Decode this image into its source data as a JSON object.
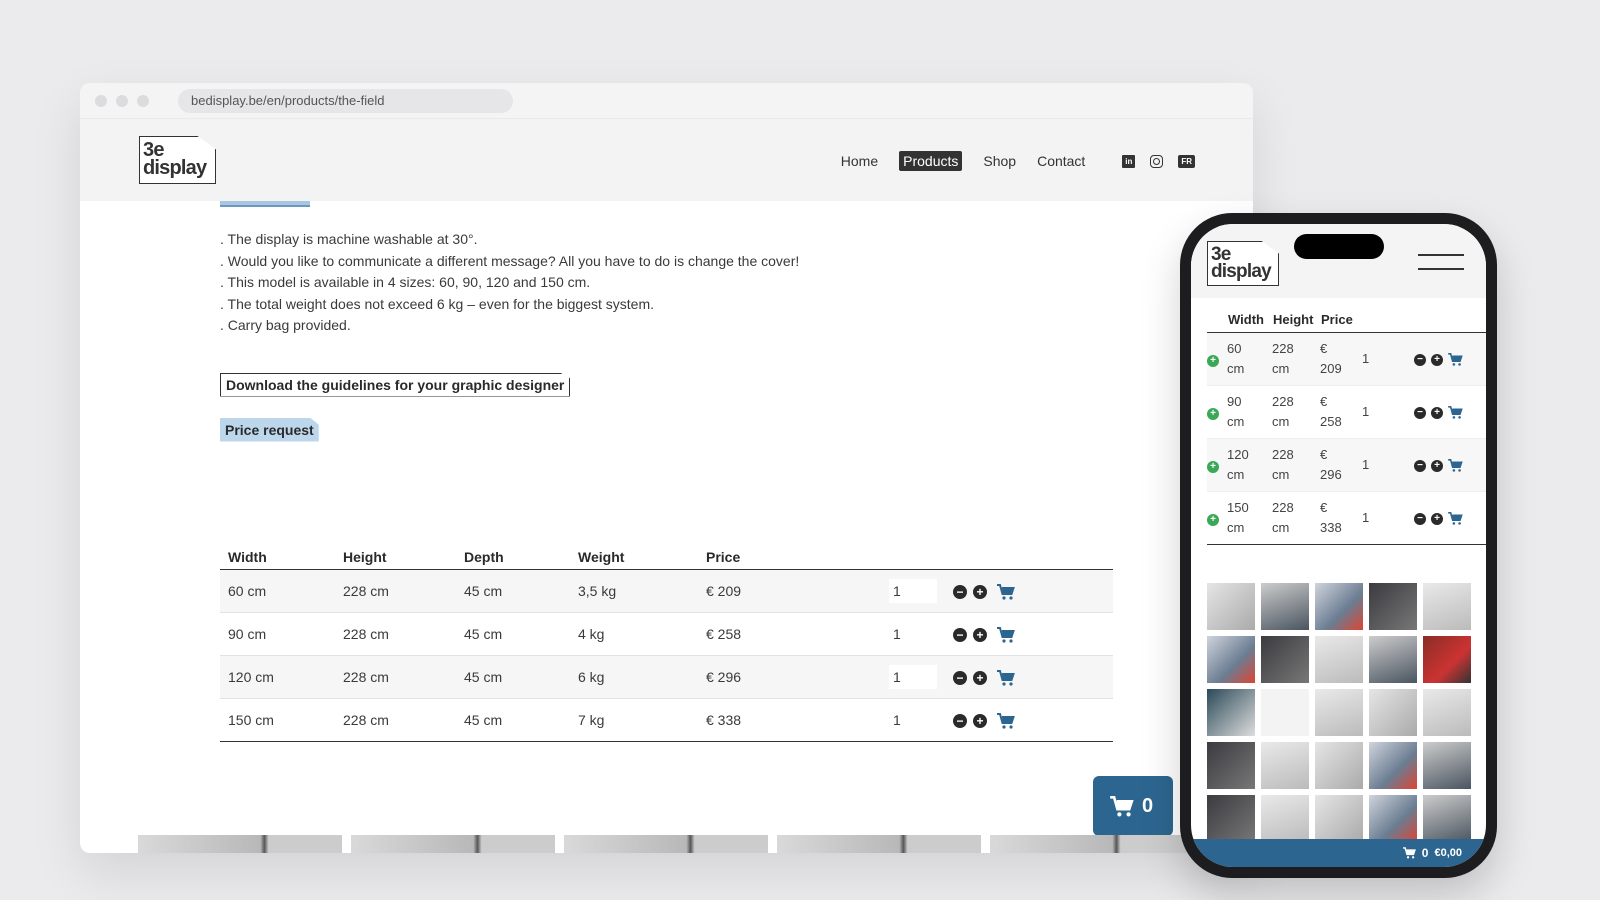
{
  "browser": {
    "url": "bedisplay.be/en/products/the-field"
  },
  "logo": {
    "line1": "3e",
    "line2": "display"
  },
  "nav": {
    "items": [
      {
        "label": "Home",
        "active": false
      },
      {
        "label": "Products",
        "active": true
      },
      {
        "label": "Shop",
        "active": false
      },
      {
        "label": "Contact",
        "active": false
      }
    ],
    "language": "FR"
  },
  "content": {
    "features": [
      ". The display is machine washable at 30°.",
      ". Would you like to communicate a different message? All you have to do is change the cover!",
      ". This model is available in 4 sizes: 60, 90, 120 and 150 cm.",
      ". The total weight does not exceed 6 kg – even for the biggest system.",
      ". Carry bag provided."
    ],
    "download_label": "Download the guidelines for your graphic designer",
    "price_request_label": "Price request"
  },
  "table": {
    "headers": [
      "Width",
      "Height",
      "Depth",
      "Weight",
      "Price"
    ],
    "rows": [
      {
        "width": "60 cm",
        "height": "228 cm",
        "depth": "45 cm",
        "weight": "3,5 kg",
        "price": "€ 209",
        "qty": "1"
      },
      {
        "width": "90 cm",
        "height": "228 cm",
        "depth": "45 cm",
        "weight": "4 kg",
        "price": "€ 258",
        "qty": "1"
      },
      {
        "width": "120 cm",
        "height": "228 cm",
        "depth": "45 cm",
        "weight": "6 kg",
        "price": "€ 296",
        "qty": "1"
      },
      {
        "width": "150 cm",
        "height": "228 cm",
        "depth": "45 cm",
        "weight": "7 kg",
        "price": "€ 338",
        "qty": "1"
      }
    ]
  },
  "cart": {
    "count": "0"
  },
  "mobile": {
    "headers": [
      "Width",
      "Height",
      "Price"
    ],
    "rows": [
      {
        "w1": "60",
        "w2": "cm",
        "h1": "228",
        "h2": "cm",
        "p1": "€",
        "p2": "209",
        "qty": "1"
      },
      {
        "w1": "90",
        "w2": "cm",
        "h1": "228",
        "h2": "cm",
        "p1": "€",
        "p2": "258",
        "qty": "1"
      },
      {
        "w1": "120",
        "w2": "cm",
        "h1": "228",
        "h2": "cm",
        "p1": "€",
        "p2": "296",
        "qty": "1"
      },
      {
        "w1": "150",
        "w2": "cm",
        "h1": "228",
        "h2": "cm",
        "p1": "€",
        "p2": "338",
        "qty": "1"
      }
    ],
    "cart_count": "0",
    "cart_total": "€0,00"
  },
  "colors": {
    "accent": "#2c6690",
    "price_request_bg": "#bcd6ec",
    "add_green": "#3aa857"
  }
}
